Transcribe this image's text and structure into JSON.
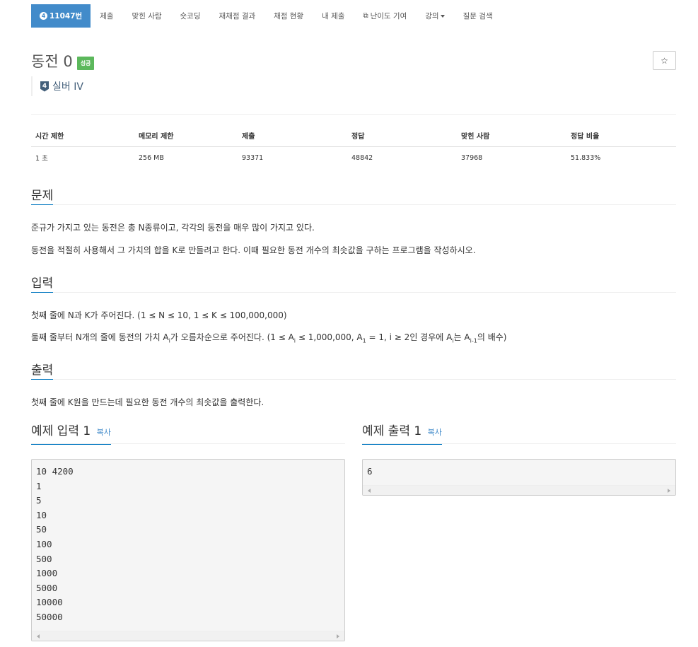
{
  "nav": {
    "problem_tier_num": "4",
    "problem_id": "11047번",
    "items": [
      "제출",
      "맞힌 사람",
      "숏코딩",
      "재채점 결과",
      "채점 현황",
      "내 제출",
      "난이도 기여",
      "강의",
      "질문 검색"
    ],
    "ext_icon": "external-link-icon"
  },
  "problem": {
    "title": "동전 0",
    "badge": "성공",
    "tier_num": "4",
    "tier_label": "실버 IV",
    "star_icon": "star-icon"
  },
  "stats": {
    "headers": [
      "시간 제한",
      "메모리 제한",
      "제출",
      "정답",
      "맞힌 사람",
      "정답 비율"
    ],
    "values": [
      "1 초",
      "256 MB",
      "93371",
      "48842",
      "37968",
      "51.833%"
    ]
  },
  "sections": {
    "problem": {
      "title": "문제",
      "p1": "준규가 가지고 있는 동전은 총 N종류이고, 각각의 동전을 매우 많이 가지고 있다.",
      "p2": "동전을 적절히 사용해서 그 가치의 합을 K로 만들려고 한다. 이때 필요한 동전 개수의 최솟값을 구하는 프로그램을 작성하시오."
    },
    "input": {
      "title": "입력",
      "p1": "첫째 줄에 N과 K가 주어진다. (1 ≤ N ≤ 10, 1 ≤ K ≤ 100,000,000)",
      "p2_a": "둘째 줄부터 N개의 줄에 동전의 가치 A",
      "p2_sub_i": "i",
      "p2_b": "가 오름차순으로 주어진다. (1 ≤ A",
      "p2_c": " ≤ 1,000,000, A",
      "p2_sub_1": "1",
      "p2_d": " = 1, i ≥ 2인 경우에 A",
      "p2_e": "는 A",
      "p2_sub_i1": "i-1",
      "p2_f": "의 배수)"
    },
    "output": {
      "title": "출력",
      "p1": "첫째 줄에 K원을 만드는데 필요한 동전 개수의 최솟값을 출력한다."
    }
  },
  "samples": {
    "input_title": "예제 입력 1",
    "output_title": "예제 출력 1",
    "copy_label": "복사",
    "input_lines": [
      "10 4200",
      "1",
      "5",
      "10",
      "50",
      "100",
      "500",
      "1000",
      "5000",
      "10000",
      "50000"
    ],
    "output_lines": [
      "6"
    ]
  }
}
